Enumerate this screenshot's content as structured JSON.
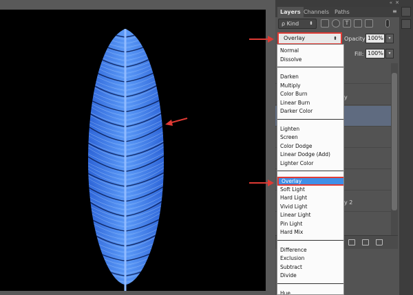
{
  "panel": {
    "tabs": [
      {
        "label": "Layers"
      },
      {
        "label": "Channels"
      },
      {
        "label": "Paths"
      }
    ],
    "top_controls": {
      "collapse": "«",
      "close": "✕",
      "menu": "≡"
    },
    "filter": {
      "kind_label": "ρ Kind",
      "kind_caret": "⬍"
    },
    "blend_mode": {
      "value": "Overlay",
      "caret": "⬍"
    },
    "opacity": {
      "label": "Opacity:",
      "value": "100%",
      "caret": "▾"
    },
    "fill": {
      "label": "Fill:",
      "value": "100%",
      "caret": "▾"
    },
    "layer_fragments": [
      "y",
      "y 2"
    ]
  },
  "dropdown": {
    "groups": [
      [
        "Normal",
        "Dissolve"
      ],
      [
        "Darken",
        "Multiply",
        "Color Burn",
        "Linear Burn",
        "Darker Color"
      ],
      [
        "Lighten",
        "Screen",
        "Color Dodge",
        "Linear Dodge (Add)",
        "Lighter Color"
      ],
      [
        "Overlay",
        "Soft Light",
        "Hard Light",
        "Vivid Light",
        "Linear Light",
        "Pin Light",
        "Hard Mix"
      ],
      [
        "Difference",
        "Exclusion",
        "Subtract",
        "Divide"
      ],
      [
        "Hue"
      ]
    ],
    "selected": "Overlay"
  },
  "colors": {
    "feather": "#3f82f0",
    "feather_light": "#9cc6ff",
    "feather_dark": "#0a1f5a",
    "annotation": "#e03a34",
    "highlight": "#3f8fe7"
  },
  "icons": [
    "search-icon",
    "image-filter-icon",
    "adjustment-filter-icon",
    "type-filter-icon",
    "shape-filter-icon",
    "smart-object-filter-icon",
    "link-icon",
    "fx-icon",
    "mask-icon",
    "folder-icon",
    "new-layer-icon",
    "trash-icon"
  ]
}
